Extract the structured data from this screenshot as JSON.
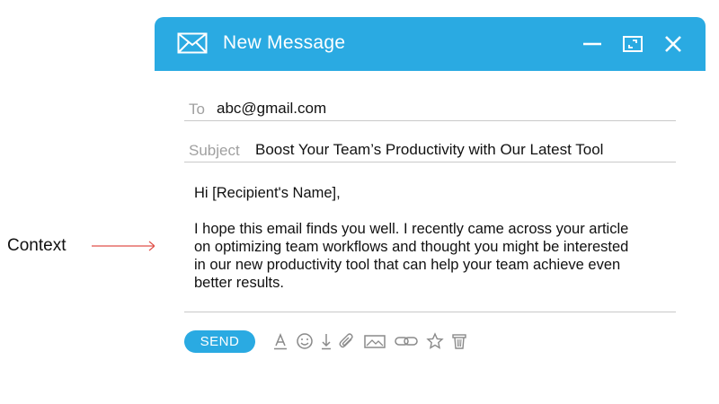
{
  "annotation": {
    "label": "Context",
    "arrow_color": "#e0524a"
  },
  "window": {
    "title": "New Message",
    "accent_color": "#2aaae2",
    "icons": [
      "mail-icon",
      "minimize-icon",
      "maximize-icon",
      "close-icon"
    ]
  },
  "fields": {
    "to_label": "To",
    "to_value": "abc@gmail.com",
    "subject_label": "Subject",
    "subject_value": "Boost Your Team’s Productivity with Our Latest Tool"
  },
  "body": {
    "greeting": "Hi [Recipient's Name],",
    "lines": [
      "I hope this email finds you well. I recently came across your article",
      "on optimizing team workflows and thought you might be interested",
      "in our new productivity tool that can help your team achieve even",
      "better results."
    ]
  },
  "toolbar": {
    "send_label": "SEND",
    "tools": [
      "text-format-icon",
      "emoji-icon",
      "download-icon",
      "attach-icon",
      "image-icon",
      "link-icon",
      "star-icon",
      "trash-icon"
    ]
  }
}
